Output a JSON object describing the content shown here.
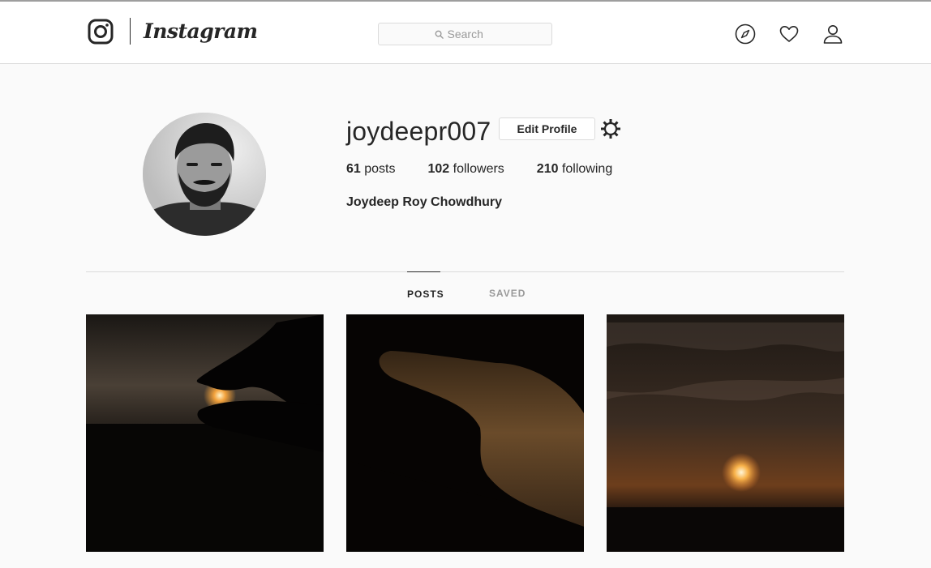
{
  "header": {
    "wordmark": "Instagram",
    "search": {
      "placeholder": "Search"
    },
    "icons": [
      "instagram-glyph-icon",
      "compass-icon",
      "heart-icon",
      "user-icon"
    ]
  },
  "profile": {
    "username": "joydeepr007",
    "edit_button_label": "Edit Profile",
    "stats": {
      "posts_count": "61",
      "posts_label": "posts",
      "followers_count": "102",
      "followers_label": "followers",
      "following_count": "210",
      "following_label": "following"
    },
    "full_name": "Joydeep Roy Chowdhury"
  },
  "tabs": [
    {
      "label": "POSTS",
      "active": true
    },
    {
      "label": "SAVED",
      "active": false
    }
  ],
  "posts": [
    {
      "description": "silhouette hand pinching sunset"
    },
    {
      "description": "silhouette fingers framing sun"
    },
    {
      "description": "sunset under cloudy sky"
    }
  ],
  "colors": {
    "text": "#262626",
    "muted": "#999999",
    "border": "#dbdbdb",
    "background": "#fafafa"
  }
}
